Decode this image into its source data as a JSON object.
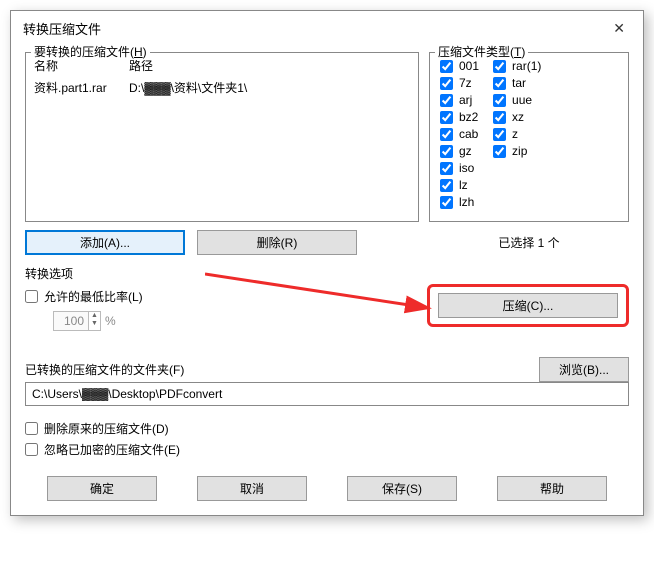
{
  "title": "转换压缩文件",
  "filesGroup": {
    "label": "要转换的压缩文件(",
    "hotkey": "H",
    "labelEnd": ")",
    "cols": {
      "name": "名称",
      "path": "路径"
    },
    "rows": [
      {
        "name": "资料.part1.rar",
        "path": "D:\\▓▓▓\\资料\\文件夹1\\"
      }
    ]
  },
  "typesGroup": {
    "label": "压缩文件类型(",
    "hotkey": "T",
    "labelEnd": ")",
    "col1": [
      {
        "label": "001",
        "checked": true
      },
      {
        "label": "7z",
        "checked": true
      },
      {
        "label": "arj",
        "checked": true
      },
      {
        "label": "bz2",
        "checked": true
      },
      {
        "label": "cab",
        "checked": true
      },
      {
        "label": "gz",
        "checked": true
      },
      {
        "label": "iso",
        "checked": true
      },
      {
        "label": "lz",
        "checked": true
      },
      {
        "label": "lzh",
        "checked": true
      }
    ],
    "col2": [
      {
        "label": "rar(1)",
        "checked": true
      },
      {
        "label": "tar",
        "checked": true
      },
      {
        "label": "uue",
        "checked": true
      },
      {
        "label": "xz",
        "checked": true
      },
      {
        "label": "z",
        "checked": true
      },
      {
        "label": "zip",
        "checked": true
      }
    ]
  },
  "buttons": {
    "add": "添加(A)...",
    "remove": "删除(R)",
    "selectedText": "已选择 1 个",
    "compress": "压缩(C)...",
    "browse": "浏览(B)...",
    "ok": "确定",
    "cancel": "取消",
    "save": "保存(S)",
    "help": "帮助"
  },
  "options": {
    "sectionLabel": "转换选项",
    "allowMinRatio": "允许的最低比率(L)",
    "ratioValue": "100",
    "percent": "%",
    "folderLabel": "已转换的压缩文件的文件夹(F)",
    "folderPath": "C:\\Users\\▓▓▓\\Desktop\\PDFconvert",
    "deleteOriginal": "删除原来的压缩文件(D)",
    "ignoreEncrypted": "忽略已加密的压缩文件(E)"
  }
}
